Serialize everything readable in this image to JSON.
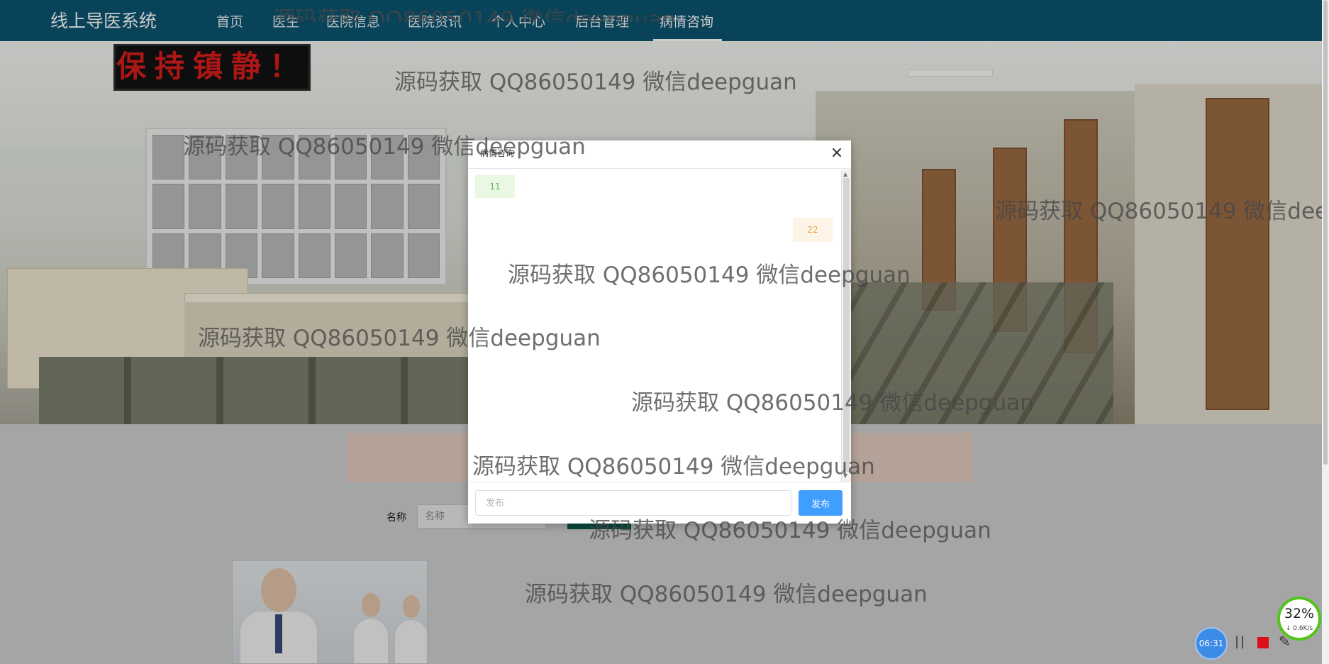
{
  "app": {
    "brand": "线上导医系统"
  },
  "nav": {
    "items": [
      {
        "label": "首页"
      },
      {
        "label": "医生"
      },
      {
        "label": "医院信息"
      },
      {
        "label": "医院资讯"
      },
      {
        "label": "个人中心"
      },
      {
        "label": "后台管理"
      },
      {
        "label": "病情咨询",
        "active": true
      }
    ]
  },
  "hero": {
    "sign_text": "保持镇静！"
  },
  "search": {
    "label": "名称",
    "placeholder": "名称"
  },
  "dialog": {
    "title": "病情咨询",
    "close_glyph": "×",
    "messages": [
      {
        "side": "left",
        "text": "11"
      },
      {
        "side": "right",
        "text": "22"
      }
    ],
    "input_placeholder": "发布",
    "send_label": "发布"
  },
  "watermark": {
    "text": "源码获取 QQ86050149 微信deepguan"
  },
  "widgets": {
    "net_percent": "32%",
    "net_speed": "↓ 0.6K/s",
    "rec_timer": "06:31",
    "pause_glyph": "||",
    "pen_glyph": "✎"
  },
  "colors": {
    "nav_bg": "#0a5470",
    "send_button": "#409eff",
    "msg_left_bg": "#eaf7e2",
    "msg_right_bg": "#fdf3e6",
    "rec_stop": "#d9101b",
    "net_ring": "#52c41a"
  }
}
